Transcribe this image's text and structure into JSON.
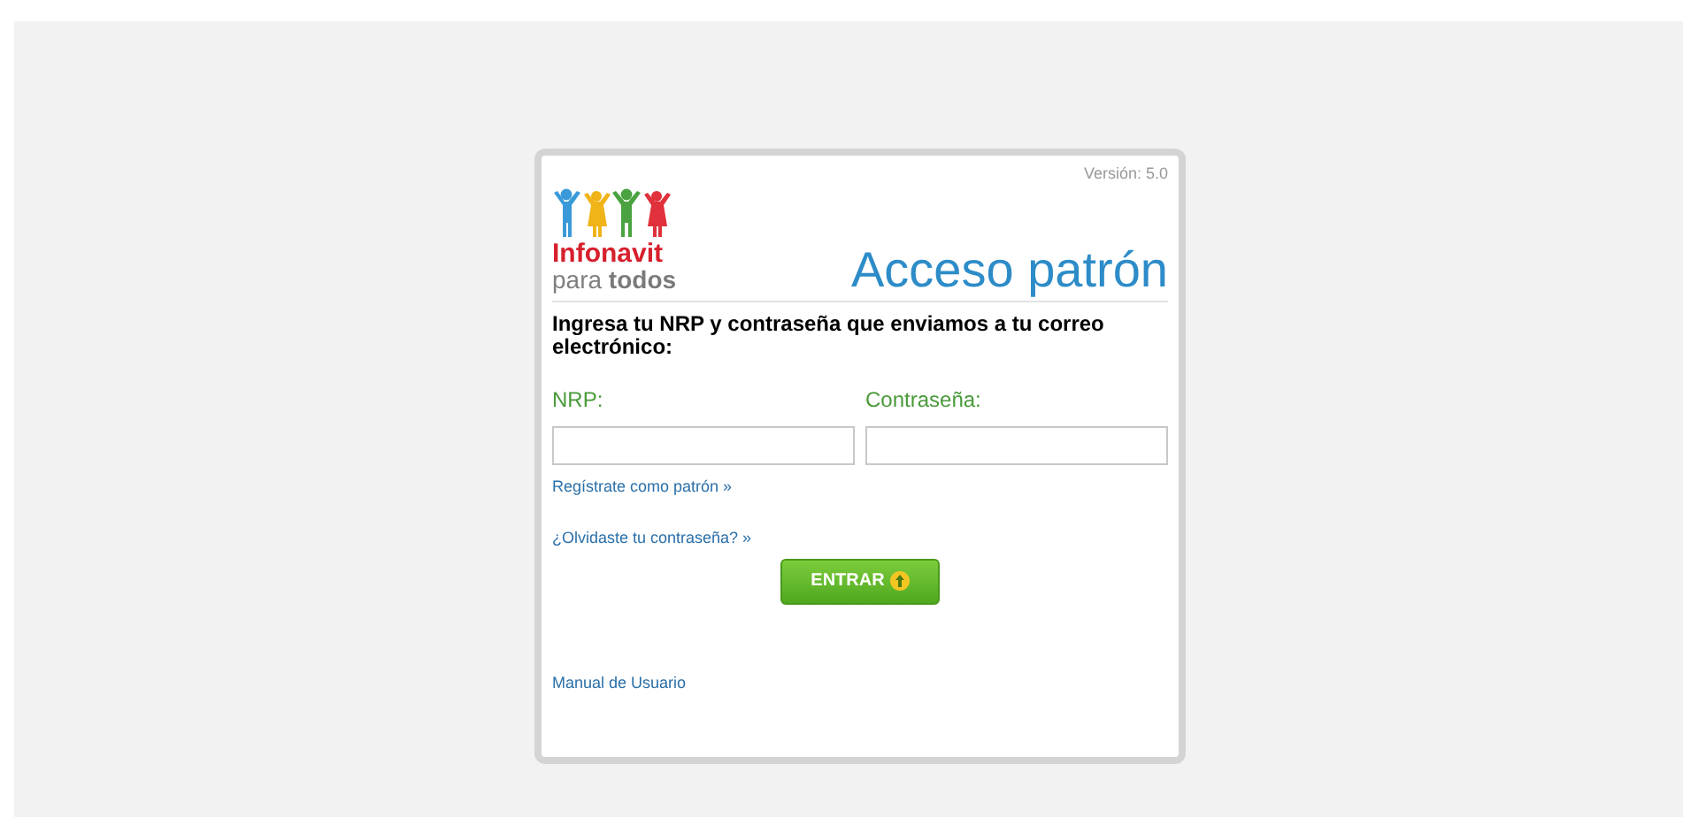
{
  "version": "Versión: 5.0",
  "logo": {
    "name": "Infonavit",
    "tagline_light": "para",
    "tagline_bold": "todos"
  },
  "title": "Acceso patrón",
  "instructions": "Ingresa tu NRP y contraseña que enviamos a tu correo electrónico:",
  "fields": [
    {
      "label": "NRP:"
    },
    {
      "label": "Contraseña:"
    }
  ],
  "links": [
    "Regístrate como patrón »",
    "¿Olvidaste tu contraseña? »"
  ],
  "submit_button": "ENTRAR",
  "manual_link": "Manual de Usuario"
}
